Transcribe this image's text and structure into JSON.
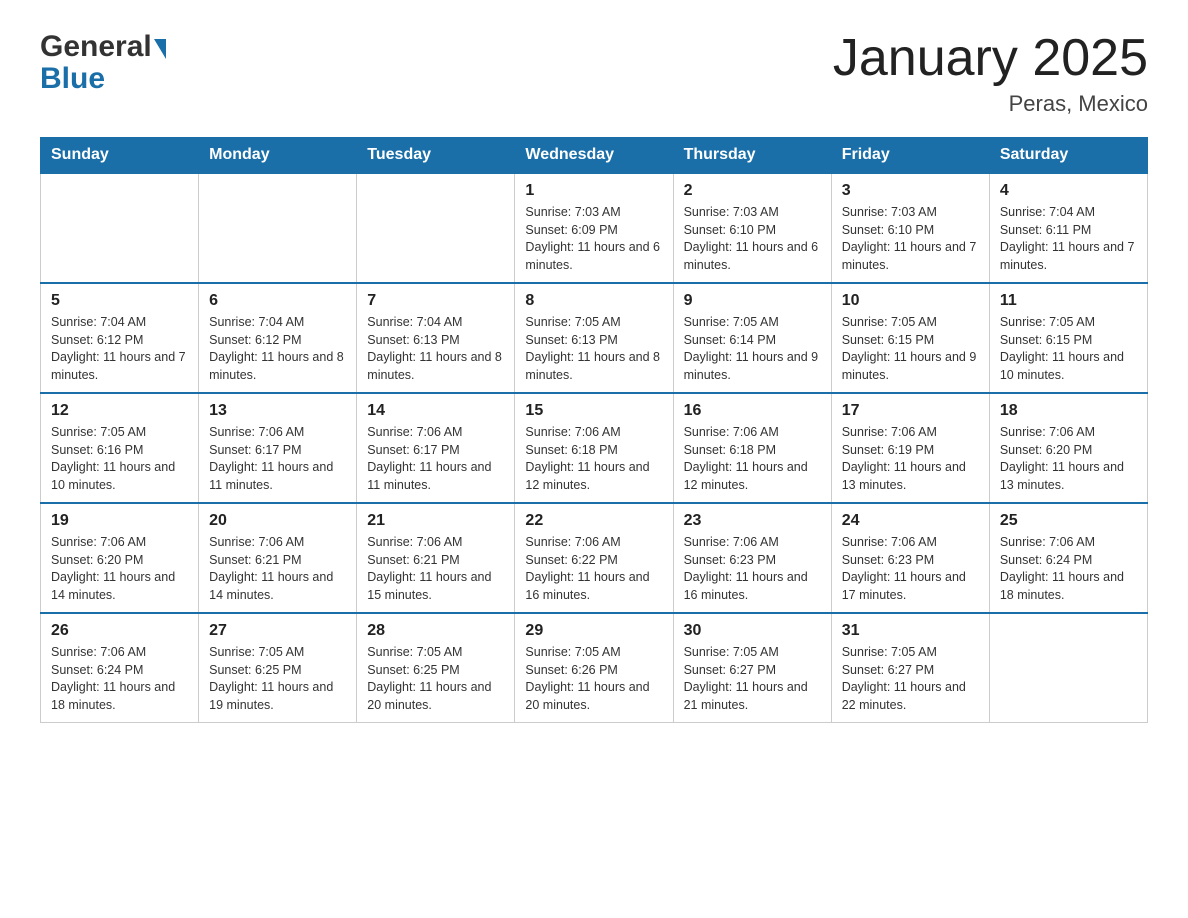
{
  "header": {
    "logo_general": "General",
    "logo_blue": "Blue",
    "title": "January 2025",
    "location": "Peras, Mexico"
  },
  "days_of_week": [
    "Sunday",
    "Monday",
    "Tuesday",
    "Wednesday",
    "Thursday",
    "Friday",
    "Saturday"
  ],
  "weeks": [
    [
      {
        "day": "",
        "info": ""
      },
      {
        "day": "",
        "info": ""
      },
      {
        "day": "",
        "info": ""
      },
      {
        "day": "1",
        "info": "Sunrise: 7:03 AM\nSunset: 6:09 PM\nDaylight: 11 hours and 6 minutes."
      },
      {
        "day": "2",
        "info": "Sunrise: 7:03 AM\nSunset: 6:10 PM\nDaylight: 11 hours and 6 minutes."
      },
      {
        "day": "3",
        "info": "Sunrise: 7:03 AM\nSunset: 6:10 PM\nDaylight: 11 hours and 7 minutes."
      },
      {
        "day": "4",
        "info": "Sunrise: 7:04 AM\nSunset: 6:11 PM\nDaylight: 11 hours and 7 minutes."
      }
    ],
    [
      {
        "day": "5",
        "info": "Sunrise: 7:04 AM\nSunset: 6:12 PM\nDaylight: 11 hours and 7 minutes."
      },
      {
        "day": "6",
        "info": "Sunrise: 7:04 AM\nSunset: 6:12 PM\nDaylight: 11 hours and 8 minutes."
      },
      {
        "day": "7",
        "info": "Sunrise: 7:04 AM\nSunset: 6:13 PM\nDaylight: 11 hours and 8 minutes."
      },
      {
        "day": "8",
        "info": "Sunrise: 7:05 AM\nSunset: 6:13 PM\nDaylight: 11 hours and 8 minutes."
      },
      {
        "day": "9",
        "info": "Sunrise: 7:05 AM\nSunset: 6:14 PM\nDaylight: 11 hours and 9 minutes."
      },
      {
        "day": "10",
        "info": "Sunrise: 7:05 AM\nSunset: 6:15 PM\nDaylight: 11 hours and 9 minutes."
      },
      {
        "day": "11",
        "info": "Sunrise: 7:05 AM\nSunset: 6:15 PM\nDaylight: 11 hours and 10 minutes."
      }
    ],
    [
      {
        "day": "12",
        "info": "Sunrise: 7:05 AM\nSunset: 6:16 PM\nDaylight: 11 hours and 10 minutes."
      },
      {
        "day": "13",
        "info": "Sunrise: 7:06 AM\nSunset: 6:17 PM\nDaylight: 11 hours and 11 minutes."
      },
      {
        "day": "14",
        "info": "Sunrise: 7:06 AM\nSunset: 6:17 PM\nDaylight: 11 hours and 11 minutes."
      },
      {
        "day": "15",
        "info": "Sunrise: 7:06 AM\nSunset: 6:18 PM\nDaylight: 11 hours and 12 minutes."
      },
      {
        "day": "16",
        "info": "Sunrise: 7:06 AM\nSunset: 6:18 PM\nDaylight: 11 hours and 12 minutes."
      },
      {
        "day": "17",
        "info": "Sunrise: 7:06 AM\nSunset: 6:19 PM\nDaylight: 11 hours and 13 minutes."
      },
      {
        "day": "18",
        "info": "Sunrise: 7:06 AM\nSunset: 6:20 PM\nDaylight: 11 hours and 13 minutes."
      }
    ],
    [
      {
        "day": "19",
        "info": "Sunrise: 7:06 AM\nSunset: 6:20 PM\nDaylight: 11 hours and 14 minutes."
      },
      {
        "day": "20",
        "info": "Sunrise: 7:06 AM\nSunset: 6:21 PM\nDaylight: 11 hours and 14 minutes."
      },
      {
        "day": "21",
        "info": "Sunrise: 7:06 AM\nSunset: 6:21 PM\nDaylight: 11 hours and 15 minutes."
      },
      {
        "day": "22",
        "info": "Sunrise: 7:06 AM\nSunset: 6:22 PM\nDaylight: 11 hours and 16 minutes."
      },
      {
        "day": "23",
        "info": "Sunrise: 7:06 AM\nSunset: 6:23 PM\nDaylight: 11 hours and 16 minutes."
      },
      {
        "day": "24",
        "info": "Sunrise: 7:06 AM\nSunset: 6:23 PM\nDaylight: 11 hours and 17 minutes."
      },
      {
        "day": "25",
        "info": "Sunrise: 7:06 AM\nSunset: 6:24 PM\nDaylight: 11 hours and 18 minutes."
      }
    ],
    [
      {
        "day": "26",
        "info": "Sunrise: 7:06 AM\nSunset: 6:24 PM\nDaylight: 11 hours and 18 minutes."
      },
      {
        "day": "27",
        "info": "Sunrise: 7:05 AM\nSunset: 6:25 PM\nDaylight: 11 hours and 19 minutes."
      },
      {
        "day": "28",
        "info": "Sunrise: 7:05 AM\nSunset: 6:25 PM\nDaylight: 11 hours and 20 minutes."
      },
      {
        "day": "29",
        "info": "Sunrise: 7:05 AM\nSunset: 6:26 PM\nDaylight: 11 hours and 20 minutes."
      },
      {
        "day": "30",
        "info": "Sunrise: 7:05 AM\nSunset: 6:27 PM\nDaylight: 11 hours and 21 minutes."
      },
      {
        "day": "31",
        "info": "Sunrise: 7:05 AM\nSunset: 6:27 PM\nDaylight: 11 hours and 22 minutes."
      },
      {
        "day": "",
        "info": ""
      }
    ]
  ]
}
